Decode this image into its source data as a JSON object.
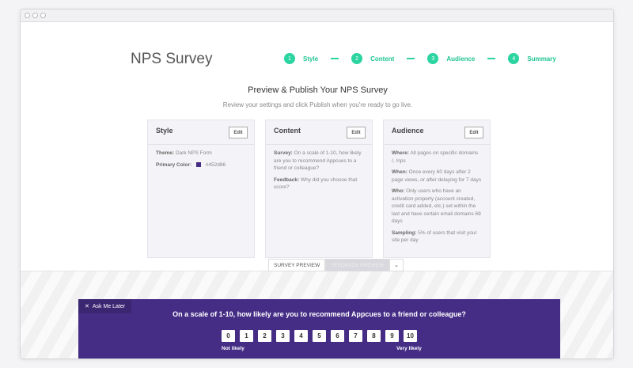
{
  "page": {
    "title": "NPS Survey",
    "heading": "Preview & Publish Your NPS Survey",
    "subheading": "Review your settings and click Publish when you're ready to go live."
  },
  "steps": [
    {
      "number": "1",
      "label": "Style"
    },
    {
      "number": "2",
      "label": "Content"
    },
    {
      "number": "3",
      "label": "Audience"
    },
    {
      "number": "4",
      "label": "Summary"
    }
  ],
  "cards": {
    "style": {
      "title": "Style",
      "edit_label": "Edit",
      "theme_label": "Theme:",
      "theme_value": "Dark NPS Form",
      "color_label": "Primary Color:",
      "color_value": "#452d86"
    },
    "content": {
      "title": "Content",
      "edit_label": "Edit",
      "survey_label": "Survey:",
      "survey_value": "On a scale of 1-10, how likely are you to recommend Appcues to a friend or colleague?",
      "feedback_label": "Feedback:",
      "feedback_value": "Why did you choose that score?"
    },
    "audience": {
      "title": "Audience",
      "edit_label": "Edit",
      "where_label": "Where:",
      "where_value": "All pages on specific domains /, /nps",
      "when_label": "When:",
      "when_value": "Once every 60 days after 2 page views, or after delaying for 7 days",
      "who_label": "Who:",
      "who_value": "Only users who have an activation property (account created, credit card added, etc.) set within the last and have certain email domains 69 days",
      "sampling_label": "Sampling:",
      "sampling_value": "5% of users that visit your site per day"
    }
  },
  "preview_tabs": {
    "survey_preview": "SURVEY PREVIEW",
    "feedback_preview": "FEEDBACK PREVIEW",
    "chevron": "⌄"
  },
  "survey": {
    "ask_later": "Ask Me Later",
    "close_glyph": "✕",
    "question": "On a scale of 1-10, how likely are you to recommend Appcues to a friend or colleague?",
    "scores": [
      "0",
      "1",
      "2",
      "3",
      "4",
      "5",
      "6",
      "7",
      "8",
      "9",
      "10"
    ],
    "not_likely": "Not likely",
    "very_likely": "Very likely",
    "background_color": "#452d86"
  },
  "colors": {
    "accent": "#2bd4a1",
    "brand": "#452d86"
  }
}
